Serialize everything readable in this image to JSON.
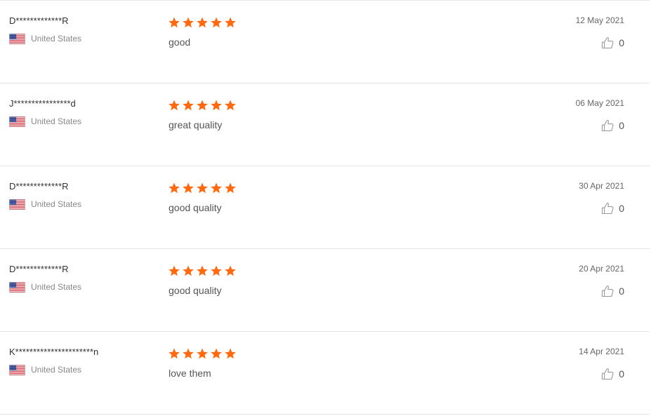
{
  "reviews": [
    {
      "buyer": "D*************R",
      "country": "United States",
      "rating": 5,
      "text": "good",
      "date": "12 May 2021",
      "helpful_count": "0"
    },
    {
      "buyer": "J****************d",
      "country": "United States",
      "rating": 5,
      "text": "great quality",
      "date": "06 May 2021",
      "helpful_count": "0"
    },
    {
      "buyer": "D*************R",
      "country": "United States",
      "rating": 5,
      "text": "good quality",
      "date": "30 Apr 2021",
      "helpful_count": "0"
    },
    {
      "buyer": "D*************R",
      "country": "United States",
      "rating": 5,
      "text": "good quality",
      "date": "20 Apr 2021",
      "helpful_count": "0"
    },
    {
      "buyer": "K**********************n",
      "country": "United States",
      "rating": 5,
      "text": "love them",
      "date": "14 Apr 2021",
      "helpful_count": "0"
    }
  ],
  "icons": {
    "flag": "us-flag-icon",
    "star": "star-icon",
    "like": "thumbs-up-icon"
  },
  "colors": {
    "star": "#ff6a10",
    "divider": "#e3e3e3",
    "text": "#333333",
    "muted": "#888888"
  }
}
